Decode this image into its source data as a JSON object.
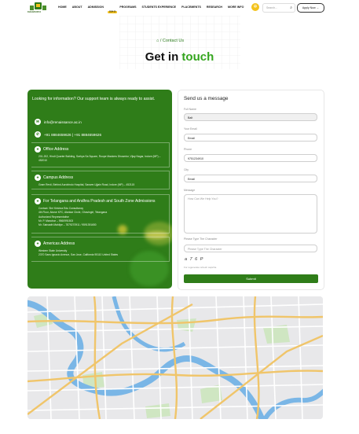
{
  "nav": {
    "logo_text": "DHANAVIDYA",
    "items": [
      "HOME",
      "ABOUT",
      "ADMISSION",
      "PROGRAMS",
      "STUDENTS EXPERIENCE",
      "PLACEMENTS",
      "RESEARCH",
      "MORE INFO"
    ],
    "admission_badge": "2024-25",
    "search_placeholder": "Search...",
    "apply_label": "Apply Now →"
  },
  "breadcrumb": {
    "separator": "/",
    "current": "Contact Us"
  },
  "title": {
    "main": "Get in",
    "accent": "touch"
  },
  "info": {
    "lead": "Looking for information? Our support team is always ready to assist.",
    "email": "info@renaissance.ac.in",
    "phone_1": "+91 8884659626",
    "phone_sep": "|",
    "phone_2": "+91 8884659626",
    "office_title": "Office Address",
    "office_body": "201-202, Hindi Quarter Building, Sarhya Sa Square, Roope Mackers Dhowntor, Vijay Nagar, Indore (MP) – 452010",
    "campus_title": "Campus Address",
    "campus_body": "Gram Revti, Behind Aurobindo Hospital, Sanwer-Ujjain Road, Indore (MP) – 452115",
    "tg_title": "For Telangana and Andhra Pradesh and South Zone Admissions",
    "tg_body": [
      "Contact: Shri Krishna Edu Consultancy",
      "4th Floor, Above KFC, Alankar Circle, Ghavingiri, Telangana",
      "Authorized Representative",
      "Mr. P. Manohar – 9560991503",
      "Mr. Sainaath Mahilye – 7879270911 / 9591391650"
    ],
    "americas_title": "Americas Address",
    "americas_body": [
      "Western State University",
      "2370 Sans Ignacio Avenue, San Jose, California 95110 United States"
    ]
  },
  "form": {
    "heading": "Send us a message",
    "full_name_label": "Full Name",
    "full_name_value": "Balt",
    "email_label": "Your Email",
    "email_value": "Email",
    "phone_label": "Phone",
    "phone_value": "9751234910",
    "city_label": "City",
    "city_value": "Email",
    "message_label": "Message",
    "message_placeholder": "How Can We Help You?",
    "captcha_label": "Please Type The Character",
    "captcha_placeholder": "Please Type The Character",
    "captcha_text": "a 7 6 P",
    "refresh_text": "For regenerate refresh captcha",
    "submit_label": "Submit"
  },
  "colors": {
    "brand_green": "#2f7d19",
    "accent_green": "#34a51e",
    "accent_yellow": "#f3c21b"
  },
  "icons": [
    "home-icon",
    "search-icon",
    "email-icon",
    "phone-icon",
    "location-icon",
    "settings-icon"
  ]
}
